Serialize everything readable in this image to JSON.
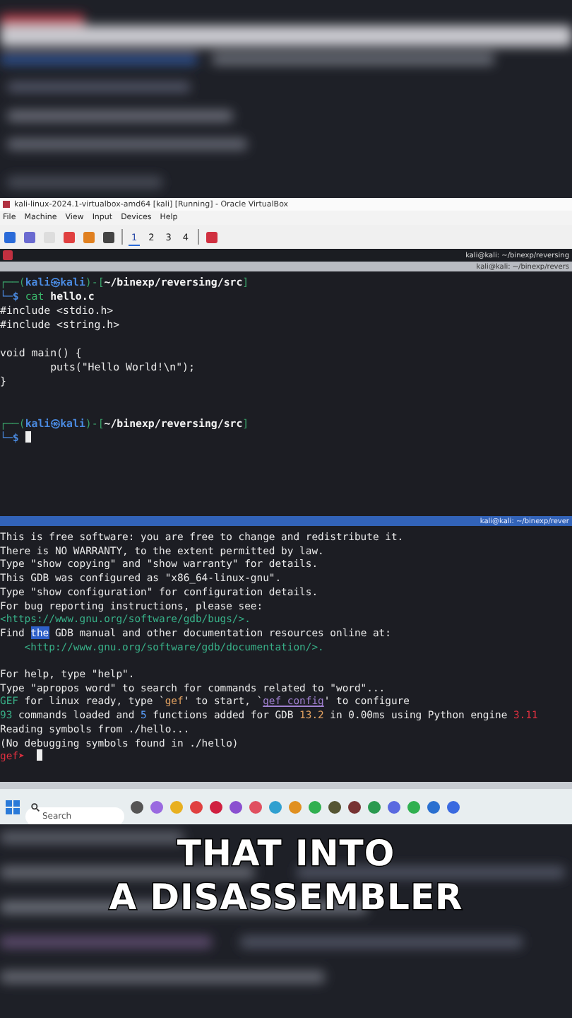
{
  "vbox": {
    "title": "kali-linux-2024.1-virtualbox-amd64 [kali] [Running] - Oracle VirtualBox",
    "menu": [
      "File",
      "Machine",
      "View",
      "Input",
      "Devices",
      "Help"
    ],
    "workspaces": [
      {
        "label": "1",
        "selected": true
      },
      {
        "label": "2",
        "selected": false
      },
      {
        "label": "3",
        "selected": false
      },
      {
        "label": "4",
        "selected": false
      }
    ]
  },
  "window_title": "kali@kali: ~/binexp/reversing",
  "terminal_top": {
    "title": "kali@kali: ~/binexp/revers",
    "lines": [
      [
        {
          "kind": "frame",
          "text": "┌──("
        },
        {
          "kind": "user",
          "text": "kali㉿kali"
        },
        {
          "kind": "frame",
          "text": ")-["
        },
        {
          "kind": "path",
          "text": "~/binexp/reversing/src"
        },
        {
          "kind": "frame",
          "text": "]"
        }
      ],
      [
        {
          "kind": "user",
          "text": "└─$ "
        },
        {
          "kind": "cmd",
          "text": "cat "
        },
        {
          "kind": "path",
          "text": "hello.c"
        }
      ],
      [
        {
          "kind": "plain",
          "text": "#include <stdio.h>"
        }
      ],
      [
        {
          "kind": "plain",
          "text": "#include <string.h>"
        }
      ],
      {
        "kind": "blank"
      },
      [
        {
          "kind": "plain",
          "text": "void main() {"
        }
      ],
      [
        {
          "kind": "plain",
          "text": "        puts(\"Hello World!\\n\");"
        }
      ],
      [
        {
          "kind": "plain",
          "text": "}"
        }
      ],
      {
        "kind": "blank"
      },
      {
        "kind": "blank"
      },
      [
        {
          "kind": "frame",
          "text": "┌──("
        },
        {
          "kind": "user",
          "text": "kali㉿kali"
        },
        {
          "kind": "frame",
          "text": ")-["
        },
        {
          "kind": "path",
          "text": "~/binexp/reversing/src"
        },
        {
          "kind": "frame",
          "text": "]"
        }
      ],
      [
        {
          "kind": "user",
          "text": "└─$ "
        },
        {
          "kind": "cursor"
        }
      ]
    ]
  },
  "terminal_bottom": {
    "title": "kali@kali: ~/binexp/rever",
    "lines": [
      [
        {
          "kind": "plain",
          "text": "This is free software: you are free to change and redistribute it."
        }
      ],
      [
        {
          "kind": "plain",
          "text": "There is NO WARRANTY, to the extent permitted by law."
        }
      ],
      [
        {
          "kind": "plain",
          "text": "Type \"show copying\" and \"show warranty\" for details."
        }
      ],
      [
        {
          "kind": "plain",
          "text": "This GDB was configured as \"x86_64-linux-gnu\"."
        }
      ],
      [
        {
          "kind": "plain",
          "text": "Type \"show configuration\" for configuration details."
        }
      ],
      [
        {
          "kind": "plain",
          "text": "For bug reporting instructions, please see:"
        }
      ],
      [
        {
          "kind": "link",
          "text": "<https://www.gnu.org/software/gdb/bugs/>."
        }
      ],
      [
        {
          "kind": "plain",
          "text": "Find "
        },
        {
          "kind": "highlight",
          "text": "the"
        },
        {
          "kind": "plain",
          "text": " GDB manual and other documentation resources online at:"
        }
      ],
      [
        {
          "kind": "link",
          "text": "    <http://www.gnu.org/software/gdb/documentation/>."
        }
      ],
      {
        "kind": "blank"
      },
      [
        {
          "kind": "plain",
          "text": "For help, type \"help\"."
        }
      ],
      [
        {
          "kind": "plain",
          "text": "Type \"apropos word\" to search for commands related to \"word\"..."
        }
      ],
      [
        {
          "kind": "link",
          "text": "GEF"
        },
        {
          "kind": "plain",
          "text": " for linux ready, type `"
        },
        {
          "kind": "accent",
          "text": "gef"
        },
        {
          "kind": "plain",
          "text": "' to start, `"
        },
        {
          "kind": "purple",
          "text": "gef config"
        },
        {
          "kind": "plain",
          "text": "' to configure"
        }
      ],
      [
        {
          "kind": "link",
          "text": "93"
        },
        {
          "kind": "plain",
          "text": " commands loaded and "
        },
        {
          "kind": "num",
          "text": "5"
        },
        {
          "kind": "plain",
          "text": " functions added for GDB "
        },
        {
          "kind": "accent",
          "text": "13.2"
        },
        {
          "kind": "plain",
          "text": " in 0.00ms using Python engine "
        },
        {
          "kind": "gef",
          "text": "3.11"
        }
      ],
      [
        {
          "kind": "plain",
          "text": "Reading symbols from ./hello..."
        }
      ],
      [
        {
          "kind": "plain",
          "text": "(No debugging symbols found in ./hello)"
        }
      ],
      [
        {
          "kind": "gef",
          "text": "gef➤  "
        },
        {
          "kind": "cursor"
        }
      ]
    ]
  },
  "taskbar": {
    "search": {
      "placeholder": "Search"
    }
  },
  "caption": [
    "THAT INTO",
    "A DISASSEMBLER"
  ]
}
